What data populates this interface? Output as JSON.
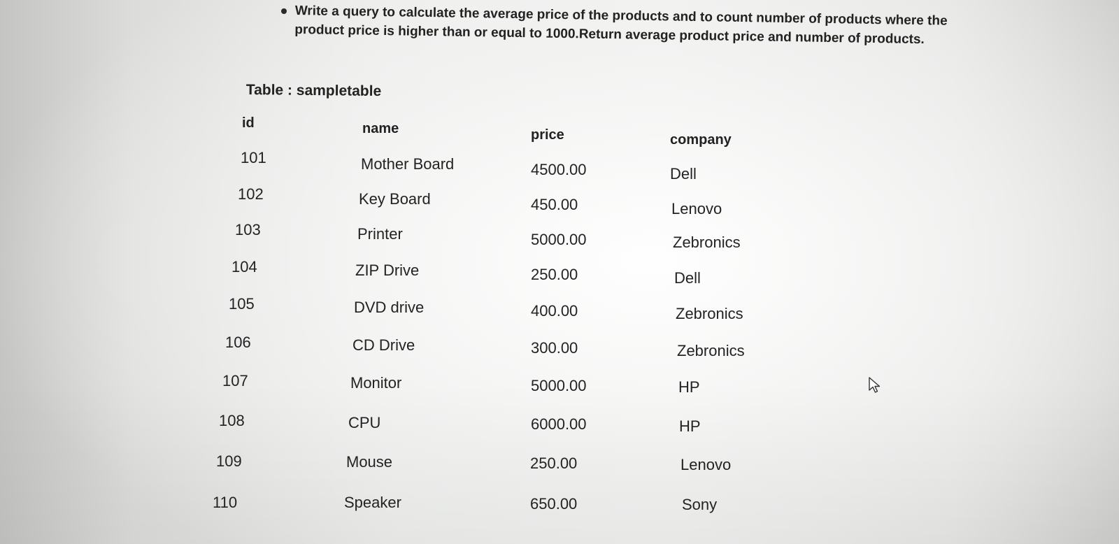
{
  "question": "Write a query to calculate the average price of the products and to count number of products where the product price is higher than or equal to 1000.Return average product price and number of products.",
  "table_title": "Table : sampletable",
  "table": {
    "columns": [
      "id",
      "name",
      "price",
      "company"
    ],
    "rows": [
      [
        "101",
        "Mother Board",
        "4500.00",
        "Dell"
      ],
      [
        "102",
        "Key Board",
        "450.00",
        "Lenovo"
      ],
      [
        "103",
        "Printer",
        "5000.00",
        "Zebronics"
      ],
      [
        "104",
        "ZIP Drive",
        "250.00",
        "Dell"
      ],
      [
        "105",
        "DVD drive",
        "400.00",
        "Zebronics"
      ],
      [
        "106",
        "CD Drive",
        "300.00",
        "Zebronics"
      ],
      [
        "107",
        "Monitor",
        "5000.00",
        "HP"
      ],
      [
        "108",
        "CPU",
        "6000.00",
        "HP"
      ],
      [
        "109",
        "Mouse",
        "250.00",
        "Lenovo"
      ],
      [
        "110",
        "Speaker",
        "650.00",
        "Sony"
      ]
    ]
  },
  "icons": {
    "cursor": "mouse-pointer-icon",
    "bullet": "bullet-icon"
  }
}
